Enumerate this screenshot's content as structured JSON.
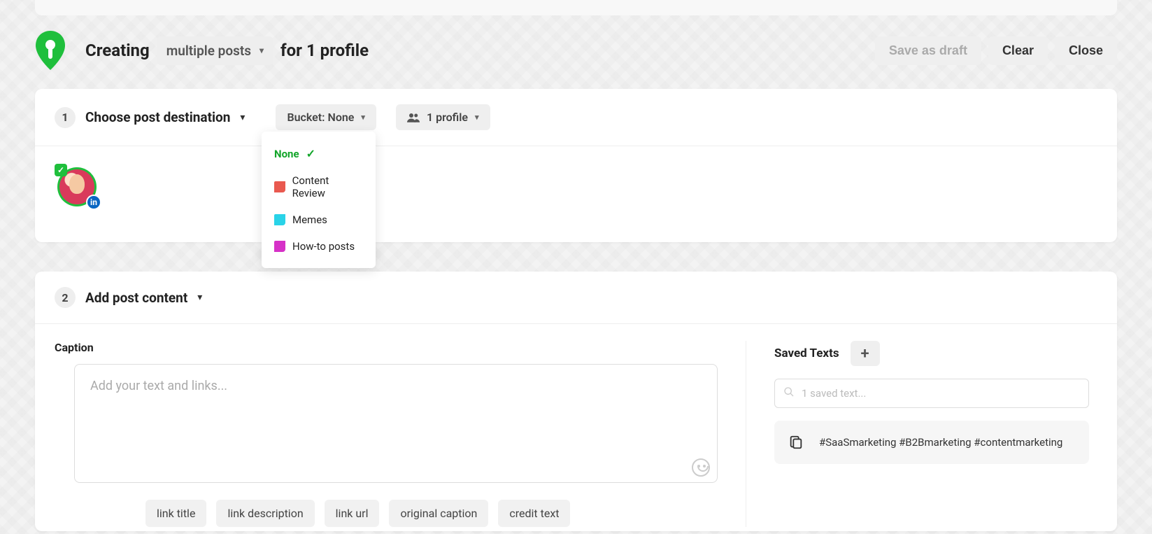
{
  "header": {
    "creating_label": "Creating",
    "multiple_posts_label": "multiple posts",
    "for_profile_label": "for 1 profile",
    "save_as_draft": "Save as draft",
    "clear": "Clear",
    "close": "Close"
  },
  "step1": {
    "num": "1",
    "title": "Choose post destination",
    "bucket_pill": "Bucket: None",
    "profile_pill": "1 profile",
    "avatar_network": "in"
  },
  "bucket_menu": {
    "none": "None",
    "items": [
      {
        "label": "Content Review",
        "color": "#e9594f"
      },
      {
        "label": "Memes",
        "color": "#29d3e8"
      },
      {
        "label": "How-to posts",
        "color": "#d631c7"
      }
    ]
  },
  "step2": {
    "num": "2",
    "title": "Add post content",
    "caption_label": "Caption",
    "caption_placeholder": "Add your text and links...",
    "chips": [
      "link title",
      "link description",
      "link url",
      "original caption",
      "credit text"
    ]
  },
  "saved": {
    "title": "Saved Texts",
    "search_placeholder": "1 saved text...",
    "item_text": "#SaaSmarketing #B2Bmarketing #contentmarketing"
  }
}
